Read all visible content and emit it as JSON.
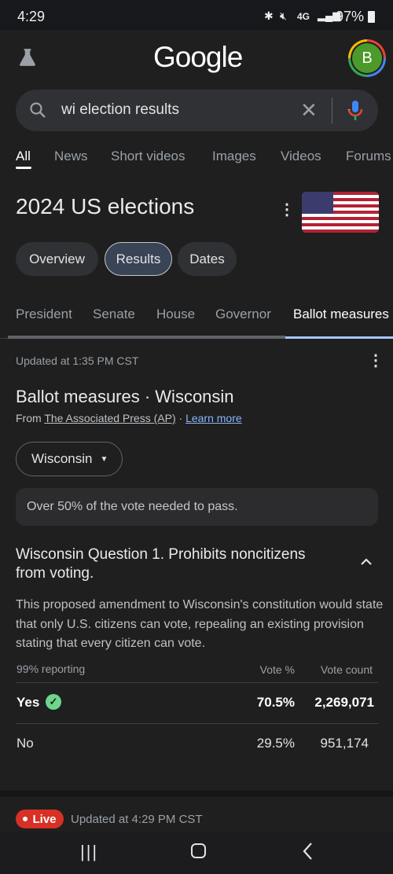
{
  "status_bar": {
    "time": "4:29",
    "network": "4G",
    "battery": "97%"
  },
  "header": {
    "logo": "Google",
    "avatar_letter": "B",
    "avatar_color": "#4c9a2a"
  },
  "search": {
    "query": "wi election results"
  },
  "search_tabs": [
    "All",
    "News",
    "Short videos",
    "Images",
    "Videos",
    "Forums"
  ],
  "card": {
    "title": "2024 US elections",
    "chips": [
      "Overview",
      "Results",
      "Dates"
    ],
    "sub_tabs": [
      "President",
      "Senate",
      "House",
      "Governor",
      "Ballot measures"
    ],
    "updated": "Updated at 1:35 PM CST",
    "section_title": "Ballot measures · Wisconsin",
    "source_prefix": "From",
    "source": "The Associated Press (AP)",
    "source_sep": "·",
    "learn_more": "Learn more",
    "state_select": "Wisconsin",
    "info": "Over 50% of the vote needed to pass.",
    "question": {
      "title": "Wisconsin Question 1. Prohibits noncitizens from voting.",
      "description": "This proposed amendment to Wisconsin's constitution would state that only U.S. citizens can vote, repealing an existing provision stating that every citizen can vote.",
      "reporting": "99% reporting",
      "col_pct": "Vote %",
      "col_count": "Vote count",
      "rows": [
        {
          "option": "Yes",
          "pct": "70.5%",
          "count": "2,269,071",
          "winner": true
        },
        {
          "option": "No",
          "pct": "29.5%",
          "count": "951,174",
          "winner": false
        }
      ]
    }
  },
  "live": {
    "badge": "Live",
    "updated": "Updated at 4:29 PM CST",
    "color": "#d93025"
  }
}
